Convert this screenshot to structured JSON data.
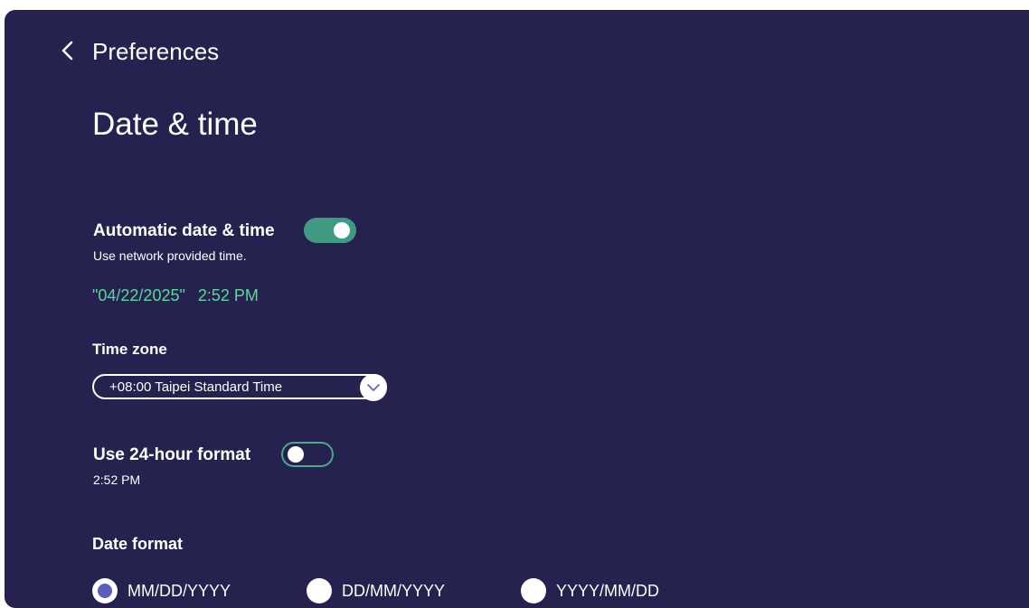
{
  "header": {
    "back_icon": "chevron-left-icon",
    "breadcrumb": "Preferences",
    "title": "Date & time"
  },
  "automatic": {
    "label": "Automatic date & time",
    "description": "Use network provided time.",
    "enabled": true,
    "current_date": "\"04/22/2025\"",
    "current_time": "2:52 PM"
  },
  "time_zone": {
    "label": "Time zone",
    "value": "+08:00 Taipei Standard Time",
    "dropdown_icon": "chevron-down-icon"
  },
  "hour_format": {
    "label": "Use 24-hour format",
    "preview": "2:52 PM",
    "enabled": false
  },
  "date_format": {
    "label": "Date format",
    "options": [
      {
        "label": "MM/DD/YYYY",
        "selected": true
      },
      {
        "label": "DD/MM/YYYY",
        "selected": false
      },
      {
        "label": "YYYY/MM/DD",
        "selected": false
      }
    ]
  },
  "colors": {
    "background": "#25224f",
    "accent_green": "#5ed79a",
    "toggle_on": "#3f9a82",
    "radio_selected": "#5b5fb8"
  }
}
